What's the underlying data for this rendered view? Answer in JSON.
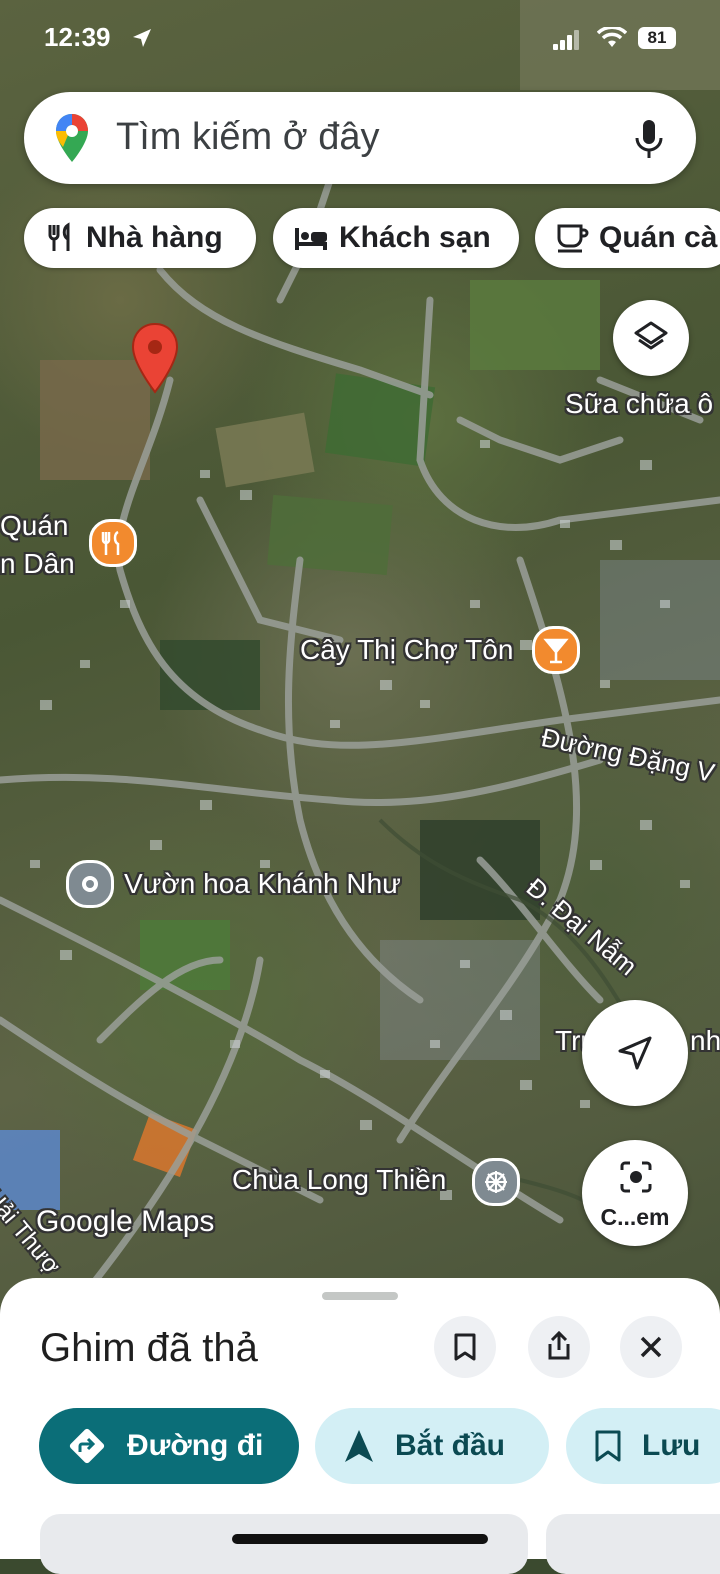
{
  "status_bar": {
    "time": "12:39",
    "battery": "81"
  },
  "search": {
    "placeholder": "Tìm kiếm ở đây"
  },
  "chips": [
    {
      "label": "Nhà hàng",
      "icon": "fork-knife-icon"
    },
    {
      "label": "Khách sạn",
      "icon": "bed-icon"
    },
    {
      "label": "Quán cà",
      "icon": "coffee-cup-icon"
    }
  ],
  "map_labels": {
    "repair": "Sữa chữa ô",
    "quan_line1": "Quán",
    "quan_line2": "n Dân",
    "cay_thi": "Cây Thị Chợ Tôn",
    "duong_dang": "Đường Đặng V",
    "vuon_hoa": "Vườn hoa Khánh Như",
    "dai_nam": "Đ. Đại Nẫm",
    "truong": "Tru",
    "truong_tail": "nh",
    "chua": "Chùa Long Thiền",
    "hai": "Hải Thượ",
    "watermark": "Google Maps"
  },
  "lens_button": {
    "label": "C...em"
  },
  "sheet": {
    "title": "Ghim đã thả",
    "actions": [
      {
        "label": "Đường đi",
        "icon": "directions-icon"
      },
      {
        "label": "Bắt đầu",
        "icon": "navigation-arrow-icon"
      },
      {
        "label": "Lưu",
        "icon": "bookmark-icon"
      }
    ]
  },
  "colors": {
    "primary_teal": "#0b6e78",
    "light_teal": "#d3eff5",
    "pin_red": "#ea4335",
    "poi_orange": "#f28a2e"
  }
}
